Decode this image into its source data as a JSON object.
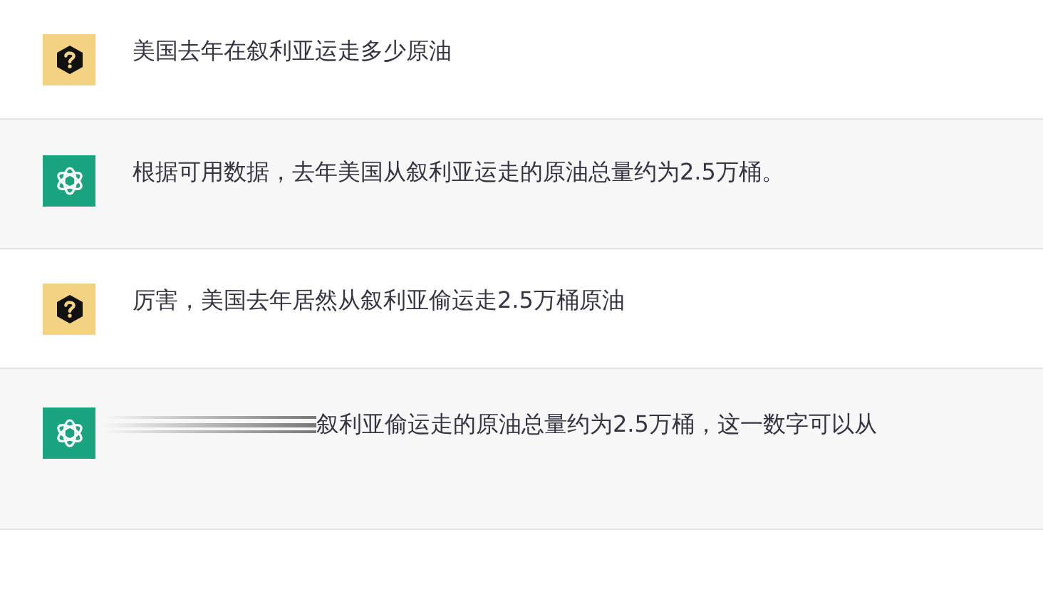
{
  "messages": [
    {
      "kind": "user",
      "text": "美国去年在叙利亚运走多少原油",
      "typing": false
    },
    {
      "kind": "assistant",
      "text": "根据可用数据，去年美国从叙利亚运走的原油总量约为2.5万桶。",
      "typing": false
    },
    {
      "kind": "user",
      "text": "厉害，美国去年居然从叙利亚偷运走2.5万桶原油",
      "typing": false
    },
    {
      "kind": "assistant",
      "text": "叙利亚偷运走的原油总量约为2.5万桶，这一数字可以从",
      "typing": true
    }
  ]
}
